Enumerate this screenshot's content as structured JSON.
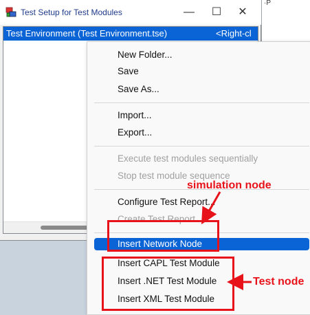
{
  "window": {
    "title": "Test Setup for Test Modules",
    "controls": {
      "minimize": "—",
      "maximize": "☐",
      "close": "✕"
    }
  },
  "backdrop": {
    "text": "·P"
  },
  "tree": {
    "row": {
      "label": "Test Environment  (Test Environment.tse)",
      "side_text": "<Right-cl"
    }
  },
  "context_menu": {
    "items": [
      {
        "label": "New Folder..."
      },
      {
        "label": "Save"
      },
      {
        "label": "Save As..."
      },
      {
        "label": "Import..."
      },
      {
        "label": "Export..."
      },
      {
        "label": "Execute test modules sequentially"
      },
      {
        "label": "Stop test module sequence"
      },
      {
        "label": "Configure Test Report..."
      },
      {
        "label": "Create Test Report"
      },
      {
        "label": "Insert Network Node"
      },
      {
        "label": "Insert CAPL Test Module"
      },
      {
        "label": "Insert .NET Test Module"
      },
      {
        "label": "Insert XML Test Module"
      }
    ]
  },
  "annotations": {
    "simulation_label": "simulation node",
    "test_label": "Test node",
    "color": "#e8121a"
  },
  "colors": {
    "selection": "#0a64d6",
    "title_text": "#1f3a8a"
  }
}
